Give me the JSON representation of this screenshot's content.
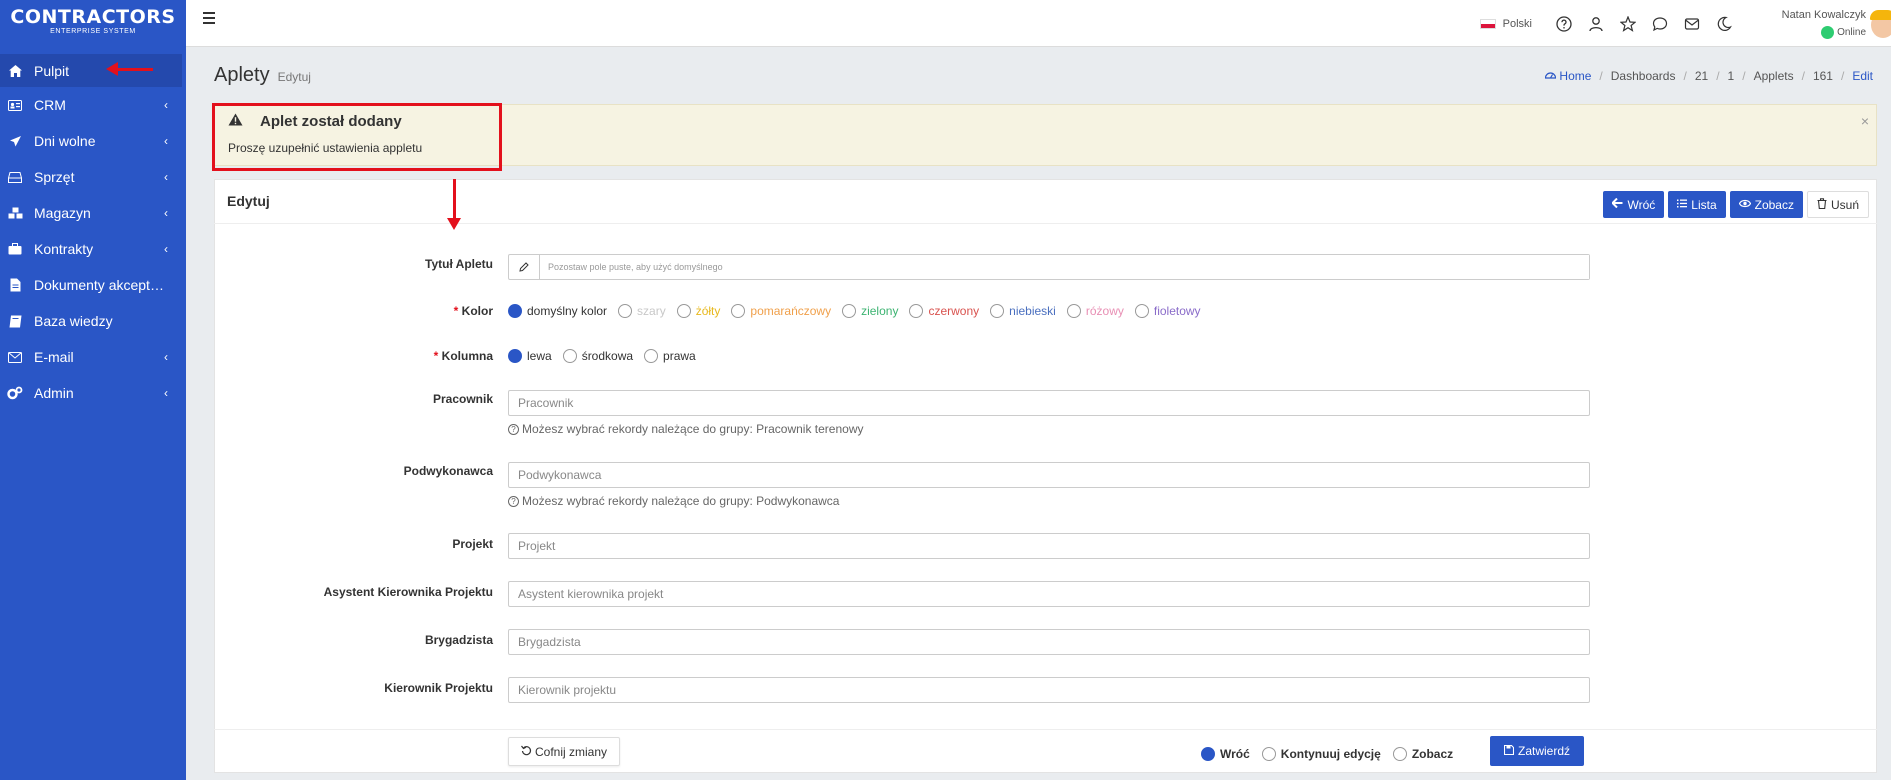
{
  "brand": {
    "name": "CONTRACTORS",
    "tagline": "ENTERPRISE SYSTEM"
  },
  "sidebar": {
    "items": [
      {
        "label": "Pulpit",
        "icon": "home-icon",
        "chevron": ""
      },
      {
        "label": "CRM",
        "icon": "address-card-icon",
        "chevron": "‹"
      },
      {
        "label": "Dni wolne",
        "icon": "plane-icon",
        "chevron": "‹"
      },
      {
        "label": "Sprzęt",
        "icon": "hdd-icon",
        "chevron": "‹"
      },
      {
        "label": "Magazyn",
        "icon": "cubes-icon",
        "chevron": "‹"
      },
      {
        "label": "Kontrakty",
        "icon": "briefcase-icon",
        "chevron": "‹"
      },
      {
        "label": "Dokumenty akceptacji",
        "icon": "file-icon",
        "chevron": ""
      },
      {
        "label": "Baza wiedzy",
        "icon": "book-icon",
        "chevron": ""
      },
      {
        "label": "E-mail",
        "icon": "envelope-icon",
        "chevron": "‹"
      },
      {
        "label": "Admin",
        "icon": "cogs-icon",
        "chevron": "‹"
      }
    ]
  },
  "topbar": {
    "language": "Polski",
    "user_name": "Natan Kowalczyk",
    "user_status": "Online"
  },
  "page": {
    "title": "Aplety",
    "subtitle": "Edytuj"
  },
  "breadcrumb": {
    "home": "Home",
    "items": [
      "Dashboards",
      "21",
      "1",
      "Applets",
      "161"
    ],
    "last": "Edit"
  },
  "alert": {
    "title": "Aplet został dodany",
    "text": "Proszę uzupełnić ustawienia appletu",
    "close": "×"
  },
  "card": {
    "title": "Edytuj",
    "actions": {
      "back": "Wróć",
      "list": "Lista",
      "view": "Zobacz",
      "delete": "Usuń"
    }
  },
  "form": {
    "title_label": "Tytuł Apletu",
    "title_placeholder": "Pozostaw pole puste, aby użyć domyślnego",
    "color_label": "Kolor",
    "colors": [
      {
        "label": "domyślny kolor",
        "color": "#333333",
        "checked": true
      },
      {
        "label": "szary",
        "color": "#c8c8c8",
        "checked": false
      },
      {
        "label": "żółty",
        "color": "#e8b91e",
        "checked": false
      },
      {
        "label": "pomarańczowy",
        "color": "#f0a04b",
        "checked": false
      },
      {
        "label": "zielony",
        "color": "#3cb371",
        "checked": false
      },
      {
        "label": "czerwony",
        "color": "#d9534f",
        "checked": false
      },
      {
        "label": "niebieski",
        "color": "#4a6fbf",
        "checked": false
      },
      {
        "label": "różowy",
        "color": "#e88fb4",
        "checked": false
      },
      {
        "label": "fioletowy",
        "color": "#8a6cc9",
        "checked": false
      }
    ],
    "column_label": "Kolumna",
    "columns": [
      {
        "label": "lewa",
        "checked": true
      },
      {
        "label": "środkowa",
        "checked": false
      },
      {
        "label": "prawa",
        "checked": false
      }
    ],
    "worker_label": "Pracownik",
    "worker_placeholder": "Pracownik",
    "worker_hint": "Możesz wybrać rekordy należące do grupy: Pracownik terenowy",
    "subcontractor_label": "Podwykonawca",
    "subcontractor_placeholder": "Podwykonawca",
    "subcontractor_hint": "Możesz wybrać rekordy należące do grupy: Podwykonawca",
    "project_label": "Projekt",
    "project_placeholder": "Projekt",
    "assistant_label": "Asystent Kierownika Projektu",
    "assistant_placeholder": "Asystent kierownika projekt",
    "foreman_label": "Brygadzista",
    "foreman_placeholder": "Brygadzista",
    "manager_label": "Kierownik Projektu",
    "manager_placeholder": "Kierownik projektu"
  },
  "footer": {
    "revert": "Cofnij zmiany",
    "after_options": [
      {
        "label": "Wróć",
        "checked": true
      },
      {
        "label": "Kontynuuj edycję",
        "checked": false
      },
      {
        "label": "Zobacz",
        "checked": false
      }
    ],
    "submit": "Zatwierdź"
  }
}
